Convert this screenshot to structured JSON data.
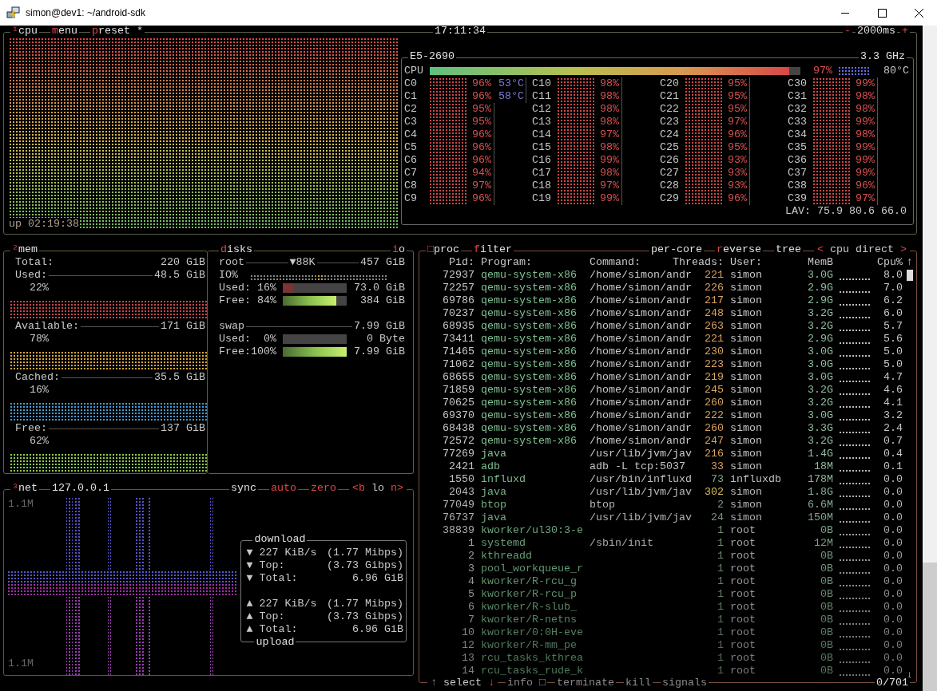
{
  "window": {
    "title": "simon@dev1: ~/android-sdk"
  },
  "cpu": {
    "menu": [
      {
        "label": "¹cpu",
        "hotkey": true
      },
      {
        "label": "menu",
        "hotkey": true
      },
      {
        "label": "preset *",
        "hotkey": true
      }
    ],
    "clock": "17:11:34",
    "interval": {
      "minus": "-",
      "value": "2000ms",
      "plus": "+"
    },
    "uptime": "up 02:19:38",
    "model": "E5-2690",
    "freq": "3.3 GHz",
    "total": {
      "label": "CPU",
      "level": 0.97,
      "percent": "97%",
      "temp": "80°C"
    },
    "cores": [
      {
        "name": "C0",
        "percent": "96%",
        "temp": "53°C"
      },
      {
        "name": "C1",
        "percent": "96%",
        "temp": "58°C"
      },
      {
        "name": "C2",
        "percent": "95%"
      },
      {
        "name": "C3",
        "percent": "95%"
      },
      {
        "name": "C4",
        "percent": "96%"
      },
      {
        "name": "C5",
        "percent": "96%"
      },
      {
        "name": "C6",
        "percent": "96%"
      },
      {
        "name": "C7",
        "percent": "94%"
      },
      {
        "name": "C8",
        "percent": "97%"
      },
      {
        "name": "C9",
        "percent": "96%"
      },
      {
        "name": "C10",
        "percent": "98%"
      },
      {
        "name": "C11",
        "percent": "98%"
      },
      {
        "name": "C12",
        "percent": "98%"
      },
      {
        "name": "C13",
        "percent": "98%"
      },
      {
        "name": "C14",
        "percent": "97%"
      },
      {
        "name": "C15",
        "percent": "98%"
      },
      {
        "name": "C16",
        "percent": "99%"
      },
      {
        "name": "C17",
        "percent": "98%"
      },
      {
        "name": "C18",
        "percent": "97%"
      },
      {
        "name": "C19",
        "percent": "99%"
      },
      {
        "name": "C20",
        "percent": "95%"
      },
      {
        "name": "C21",
        "percent": "95%"
      },
      {
        "name": "C22",
        "percent": "95%"
      },
      {
        "name": "C23",
        "percent": "97%"
      },
      {
        "name": "C24",
        "percent": "96%"
      },
      {
        "name": "C25",
        "percent": "95%"
      },
      {
        "name": "C26",
        "percent": "93%"
      },
      {
        "name": "C27",
        "percent": "93%"
      },
      {
        "name": "C28",
        "percent": "93%"
      },
      {
        "name": "C29",
        "percent": "96%"
      },
      {
        "name": "C30",
        "percent": "99%"
      },
      {
        "name": "C31",
        "percent": "98%"
      },
      {
        "name": "C32",
        "percent": "98%"
      },
      {
        "name": "C33",
        "percent": "99%"
      },
      {
        "name": "C34",
        "percent": "98%"
      },
      {
        "name": "C35",
        "percent": "99%"
      },
      {
        "name": "C36",
        "percent": "99%"
      },
      {
        "name": "C37",
        "percent": "99%"
      },
      {
        "name": "C38",
        "percent": "96%"
      },
      {
        "name": "C39",
        "percent": "97%"
      }
    ],
    "load_avg": "LAV: 75.9 80.6 66.0"
  },
  "mem": {
    "title": "²mem",
    "total": {
      "label": "Total:",
      "value": "220 GiB"
    },
    "items": [
      {
        "label": "Used:",
        "value": "48.5 GiB",
        "percent": "22%",
        "color": "#c8484b"
      },
      {
        "label": "Available:",
        "value": "171 GiB",
        "percent": "78%",
        "color": "#d9a63a"
      },
      {
        "label": "Cached:",
        "value": "35.5 GiB",
        "percent": "16%",
        "color": "#4a9ad0"
      },
      {
        "label": "Free:",
        "value": "137 GiB",
        "percent": "62%",
        "color": "#8ccc48"
      }
    ]
  },
  "disks": {
    "title": "disks",
    "io_title": "io",
    "items": [
      {
        "name": "root",
        "io": "▼88K",
        "size": "457 GiB",
        "io_label": "IO%",
        "rows": [
          {
            "kind": "used",
            "label": "Used:",
            "percent": "16%",
            "level": 0.16,
            "value": "73.0 GiB"
          },
          {
            "kind": "free",
            "label": "Free:",
            "percent": "84%",
            "level": 0.84,
            "value": "384 GiB"
          }
        ]
      },
      {
        "name": "swap",
        "size": "7.99 GiB",
        "rows": [
          {
            "kind": "used",
            "label": "Used:",
            "percent": "0%",
            "level": 0,
            "value": "0 Byte"
          },
          {
            "kind": "free",
            "label": "Free:",
            "percent": "100%",
            "level": 1,
            "value": "7.99 GiB"
          }
        ]
      }
    ]
  },
  "net": {
    "title": "³net",
    "interface": "127.0.0.1",
    "options": [
      {
        "label": "sync",
        "on": false
      },
      {
        "label": "auto",
        "on": true
      },
      {
        "label": "zero",
        "on": true
      }
    ],
    "nav": {
      "prev": "<b",
      "label": "lo",
      "next": "n>"
    },
    "scale_top": "1.1M",
    "scale_bottom": "1.1M",
    "download": {
      "title": "download",
      "rows": [
        {
          "arrow": "▼",
          "label": "227 KiB/s",
          "detail": "(1.77 Mibps)"
        },
        {
          "arrow": "▼",
          "label": "Top:",
          "detail": "(3.73 Gibps)"
        },
        {
          "arrow": "▼",
          "label": "Total:",
          "detail": "6.96 GiB"
        }
      ]
    },
    "upload": {
      "title": "upload",
      "rows": [
        {
          "arrow": "▲",
          "label": "227 KiB/s",
          "detail": "(1.77 Mibps)"
        },
        {
          "arrow": "▲",
          "label": "Top:",
          "detail": "(3.73 Gibps)"
        },
        {
          "arrow": "▲",
          "label": "Total:",
          "detail": "6.96 GiB"
        }
      ]
    }
  },
  "proc": {
    "title": "□proc",
    "filter": "filter",
    "options": [
      {
        "label": "per-core",
        "hotkey": false
      },
      {
        "label": "reverse",
        "hotkey": true
      },
      {
        "label": "tree",
        "hotkey": false
      }
    ],
    "sort": {
      "prev": "<",
      "label": "cpu direct",
      "next": ">"
    },
    "columns": [
      "Pid:",
      "Program:",
      "Command:",
      "Threads:",
      "User:",
      "MemB",
      "Cpu%"
    ],
    "rows": [
      {
        "pid": "72937",
        "program": "qemu-system-x86",
        "command": "/home/simon/andr",
        "threads": "221",
        "user": "simon",
        "mem": "3.0G",
        "cpu": "8.0"
      },
      {
        "pid": "72257",
        "program": "qemu-system-x86",
        "command": "/home/simon/andr",
        "threads": "226",
        "user": "simon",
        "mem": "2.9G",
        "cpu": "7.0"
      },
      {
        "pid": "69786",
        "program": "qemu-system-x86",
        "command": "/home/simon/andr",
        "threads": "217",
        "user": "simon",
        "mem": "2.9G",
        "cpu": "6.2"
      },
      {
        "pid": "70237",
        "program": "qemu-system-x86",
        "command": "/home/simon/andr",
        "threads": "248",
        "user": "simon",
        "mem": "3.2G",
        "cpu": "6.0"
      },
      {
        "pid": "68935",
        "program": "qemu-system-x86",
        "command": "/home/simon/andr",
        "threads": "263",
        "user": "simon",
        "mem": "3.2G",
        "cpu": "5.7"
      },
      {
        "pid": "73411",
        "program": "qemu-system-x86",
        "command": "/home/simon/andr",
        "threads": "221",
        "user": "simon",
        "mem": "2.9G",
        "cpu": "5.6"
      },
      {
        "pid": "71465",
        "program": "qemu-system-x86",
        "command": "/home/simon/andr",
        "threads": "230",
        "user": "simon",
        "mem": "3.0G",
        "cpu": "5.0"
      },
      {
        "pid": "71062",
        "program": "qemu-system-x86",
        "command": "/home/simon/andr",
        "threads": "223",
        "user": "simon",
        "mem": "3.0G",
        "cpu": "5.0"
      },
      {
        "pid": "68655",
        "program": "qemu-system-x86",
        "command": "/home/simon/andr",
        "threads": "219",
        "user": "simon",
        "mem": "3.0G",
        "cpu": "4.7"
      },
      {
        "pid": "71859",
        "program": "qemu-system-x86",
        "command": "/home/simon/andr",
        "threads": "245",
        "user": "simon",
        "mem": "3.2G",
        "cpu": "4.6"
      },
      {
        "pid": "70625",
        "program": "qemu-system-x86",
        "command": "/home/simon/andr",
        "threads": "260",
        "user": "simon",
        "mem": "3.2G",
        "cpu": "4.1"
      },
      {
        "pid": "69370",
        "program": "qemu-system-x86",
        "command": "/home/simon/andr",
        "threads": "222",
        "user": "simon",
        "mem": "3.0G",
        "cpu": "3.2"
      },
      {
        "pid": "68438",
        "program": "qemu-system-x86",
        "command": "/home/simon/andr",
        "threads": "260",
        "user": "simon",
        "mem": "3.3G",
        "cpu": "2.4"
      },
      {
        "pid": "72572",
        "program": "qemu-system-x86",
        "command": "/home/simon/andr",
        "threads": "247",
        "user": "simon",
        "mem": "3.2G",
        "cpu": "0.7"
      },
      {
        "pid": "77269",
        "program": "java",
        "command": "/usr/lib/jvm/jav",
        "threads": "216",
        "user": "simon",
        "mem": "1.4G",
        "cpu": "0.4"
      },
      {
        "pid": "2421",
        "program": "adb",
        "command": "adb -L tcp:5037",
        "threads": "33",
        "user": "simon",
        "mem": "18M",
        "cpu": "0.1"
      },
      {
        "pid": "1550",
        "program": "influxd",
        "command": "/usr/bin/influxd",
        "threads": "73",
        "user": "influxdb",
        "mem": "178M",
        "cpu": "0.0"
      },
      {
        "pid": "2043",
        "program": "java",
        "command": "/usr/lib/jvm/jav",
        "threads": "302",
        "user": "simon",
        "mem": "1.8G",
        "cpu": "0.0"
      },
      {
        "pid": "77049",
        "program": "btop",
        "command": "btop",
        "threads": "2",
        "user": "simon",
        "mem": "6.6M",
        "cpu": "0.0"
      },
      {
        "pid": "76737",
        "program": "java",
        "command": "/usr/lib/jvm/jav",
        "threads": "24",
        "user": "simon",
        "mem": "150M",
        "cpu": "0.0"
      },
      {
        "pid": "38839",
        "program": "kworker/ul30:3-e",
        "threads": "1",
        "user": "root",
        "mem": "0B",
        "cpu": "0.0"
      },
      {
        "pid": "1",
        "program": "systemd",
        "command": "/sbin/init",
        "threads": "1",
        "user": "root",
        "mem": "12M",
        "cpu": "0.0"
      },
      {
        "pid": "2",
        "program": "kthreadd",
        "threads": "1",
        "user": "root",
        "mem": "0B",
        "cpu": "0.0"
      },
      {
        "pid": "3",
        "program": "pool_workqueue_r",
        "threads": "1",
        "user": "root",
        "mem": "0B",
        "cpu": "0.0"
      },
      {
        "pid": "4",
        "program": "kworker/R-rcu_g",
        "threads": "1",
        "user": "root",
        "mem": "0B",
        "cpu": "0.0"
      },
      {
        "pid": "5",
        "program": "kworker/R-rcu_p",
        "threads": "1",
        "user": "root",
        "mem": "0B",
        "cpu": "0.0"
      },
      {
        "pid": "6",
        "program": "kworker/R-slub_",
        "threads": "1",
        "user": "root",
        "mem": "0B",
        "cpu": "0.0"
      },
      {
        "pid": "7",
        "program": "kworker/R-netns",
        "threads": "1",
        "user": "root",
        "mem": "0B",
        "cpu": "0.0"
      },
      {
        "pid": "10",
        "program": "kworker/0:0H-eve",
        "threads": "1",
        "user": "root",
        "mem": "0B",
        "cpu": "0.0"
      },
      {
        "pid": "12",
        "program": "kworker/R-mm_pe",
        "threads": "1",
        "user": "root",
        "mem": "0B",
        "cpu": "0.0"
      },
      {
        "pid": "13",
        "program": "rcu_tasks_kthrea",
        "threads": "1",
        "user": "root",
        "mem": "0B",
        "cpu": "0.0"
      },
      {
        "pid": "14",
        "program": "rcu_tasks_rude_k",
        "threads": "1",
        "user": "root",
        "mem": "0B",
        "cpu": "0.0"
      }
    ],
    "scroll_up": "↑",
    "scroll_down": "↓",
    "footer": {
      "select": {
        "up": "↑",
        "label": "select",
        "down": "↓"
      },
      "actions": [
        "info □",
        "terminate",
        "kill",
        "signals"
      ],
      "count": "0/701"
    }
  }
}
